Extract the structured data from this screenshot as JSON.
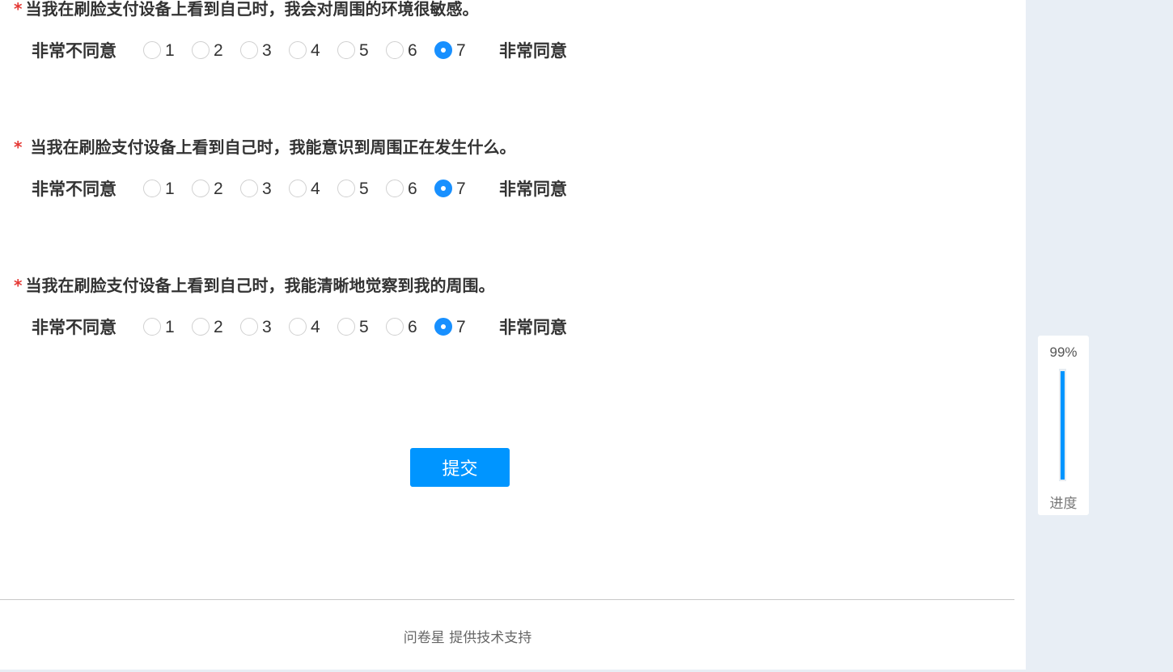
{
  "questions": [
    {
      "required_mark": "*",
      "text": "当我在刷脸支付设备上看到自己时，我会对周围的环境很敏感。",
      "low_label": "非常不同意",
      "high_label": "非常同意",
      "options": [
        "1",
        "2",
        "3",
        "4",
        "5",
        "6",
        "7"
      ],
      "selected": "7"
    },
    {
      "required_mark": "*",
      "text": "当我在刷脸支付设备上看到自己时，我能意识到周围正在发生什么。",
      "low_label": "非常不同意",
      "high_label": "非常同意",
      "options": [
        "1",
        "2",
        "3",
        "4",
        "5",
        "6",
        "7"
      ],
      "selected": "7"
    },
    {
      "required_mark": "*",
      "text": "当我在刷脸支付设备上看到自己时，我能清晰地觉察到我的周围。",
      "low_label": "非常不同意",
      "high_label": "非常同意",
      "options": [
        "1",
        "2",
        "3",
        "4",
        "5",
        "6",
        "7"
      ],
      "selected": "7"
    }
  ],
  "submit_label": "提交",
  "footer_text": "问卷星 提供技术支持",
  "progress": {
    "percent_text": "99%",
    "value": 0.99,
    "label": "进度",
    "color": "#0095ff"
  },
  "colors": {
    "accent": "#0095ff",
    "required": "#e53935",
    "sidebar_bg": "#e8eef5"
  }
}
